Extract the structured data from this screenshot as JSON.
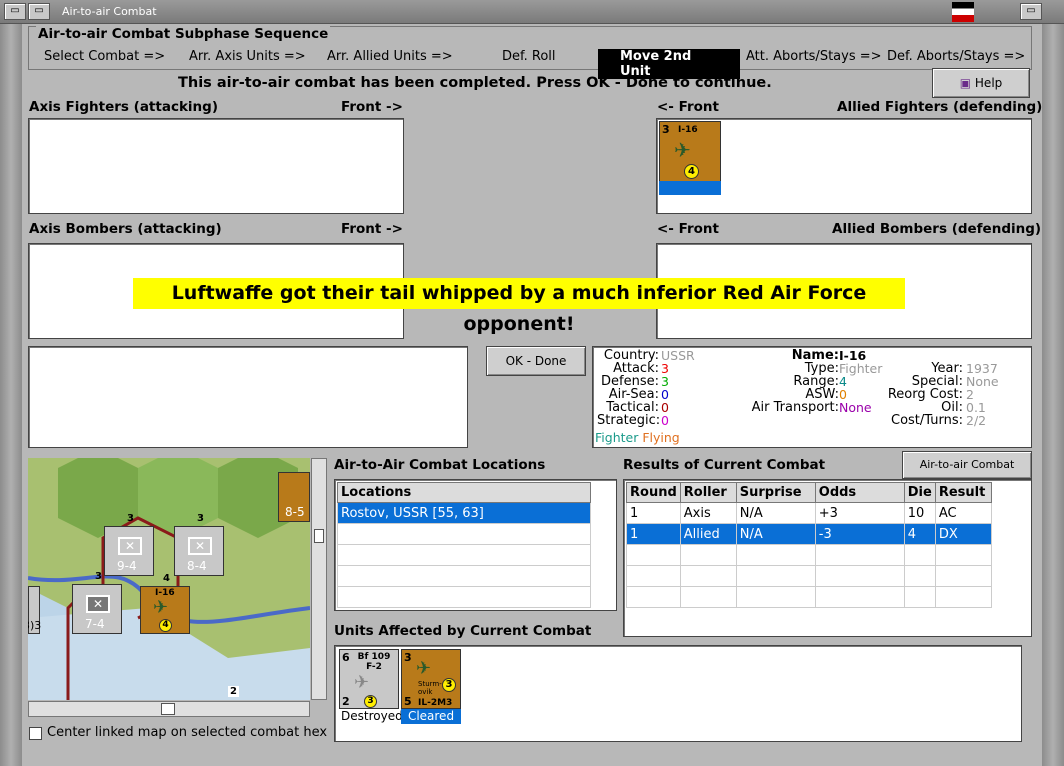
{
  "window": {
    "title": "Air-to-air Combat"
  },
  "sequence": {
    "title": "Air-to-air Combat Subphase Sequence",
    "steps": [
      "Select Combat =>",
      "Arr. Axis Units =>",
      "Arr. Allied Units =>",
      "Def. Roll",
      "Move 2nd Unit",
      "Att. Aborts/Stays =>",
      "Def. Aborts/Stays =>"
    ],
    "active_step": "Move 2nd Unit"
  },
  "message": "This air-to-air combat has been completed.  Press OK - Done to continue.",
  "help_label": "Help",
  "labels": {
    "axis_fighters": "Axis Fighters (attacking)",
    "front_right": "Front ->",
    "front_left": "<- Front",
    "allied_fighters": "Allied Fighters (defending)",
    "axis_bombers": "Axis Bombers (attacking)",
    "allied_bombers": "Allied Bombers (defending)"
  },
  "banner": "Luftwaffe got their tail whipped by a much inferior Red Air Force opponent!",
  "ok_done": "OK - Done",
  "allied_fighter_counter": {
    "name": "I-16",
    "attack": "3",
    "defense": "4"
  },
  "info": {
    "country_k": "Country:",
    "country": "USSR",
    "attack_k": "Attack:",
    "attack": "3",
    "defense_k": "Defense:",
    "defense": "3",
    "airsea_k": "Air-Sea:",
    "airsea": "0",
    "tactical_k": "Tactical:",
    "tactical": "0",
    "strategic_k": "Strategic:",
    "strategic": "0",
    "status1": "Fighter",
    "status2": "Flying",
    "name_k": "Name:",
    "name": "I-16",
    "type_k": "Type:",
    "type": "Fighter",
    "range_k": "Range:",
    "range": "4",
    "asw_k": "ASW:",
    "asw": "0",
    "airtransport_k": "Air Transport:",
    "airtransport": "None",
    "year_k": "Year:",
    "year": "1937",
    "special_k": "Special:",
    "special": "None",
    "reorg_k": "Reorg Cost:",
    "reorg": "2",
    "oil_k": "Oil:",
    "oil": "0.1",
    "costturns_k": "Cost/Turns:",
    "costturns": "2/2"
  },
  "locations": {
    "title": "Air-to-Air Combat Locations",
    "header": "Locations",
    "rows": [
      "Rostov, USSR [55, 63]"
    ]
  },
  "results": {
    "title": "Results of Current Combat",
    "chart_button": "Air-to-air Combat Chart",
    "headers": [
      "Round",
      "Roller",
      "Surprise",
      "Odds",
      "Die",
      "Result"
    ],
    "rows": [
      [
        "1",
        "Axis",
        "N/A",
        "+3",
        "10",
        "AC"
      ],
      [
        "1",
        "Allied",
        "N/A",
        "-3",
        "4",
        "DX"
      ]
    ]
  },
  "affected": {
    "title": "Units Affected by Current Combat",
    "unit1": {
      "name": "Bf 109 F-2",
      "top": "6",
      "bottom": "2",
      "coin": "3",
      "status": "Destroyed"
    },
    "unit2": {
      "name": "IL-2M3",
      "top": "3",
      "bottom": "5",
      "coin": "3",
      "status": "Cleared",
      "extra": "Sturm-ovik"
    }
  },
  "map": {
    "units": [
      {
        "top": "3",
        "val": "9-4",
        "corps": "XXX"
      },
      {
        "top": "3",
        "val": "8-4",
        "corps": "XXX"
      },
      {
        "top": "3",
        "val": "7-4",
        "corps": "XXX"
      },
      {
        "top": "4",
        "val": "I-16",
        "coin": "4"
      }
    ],
    "edge_val": "8-5",
    "edge_val2": "3)3",
    "hexnum": "2"
  },
  "center_linked": "Center linked map on selected combat hex"
}
